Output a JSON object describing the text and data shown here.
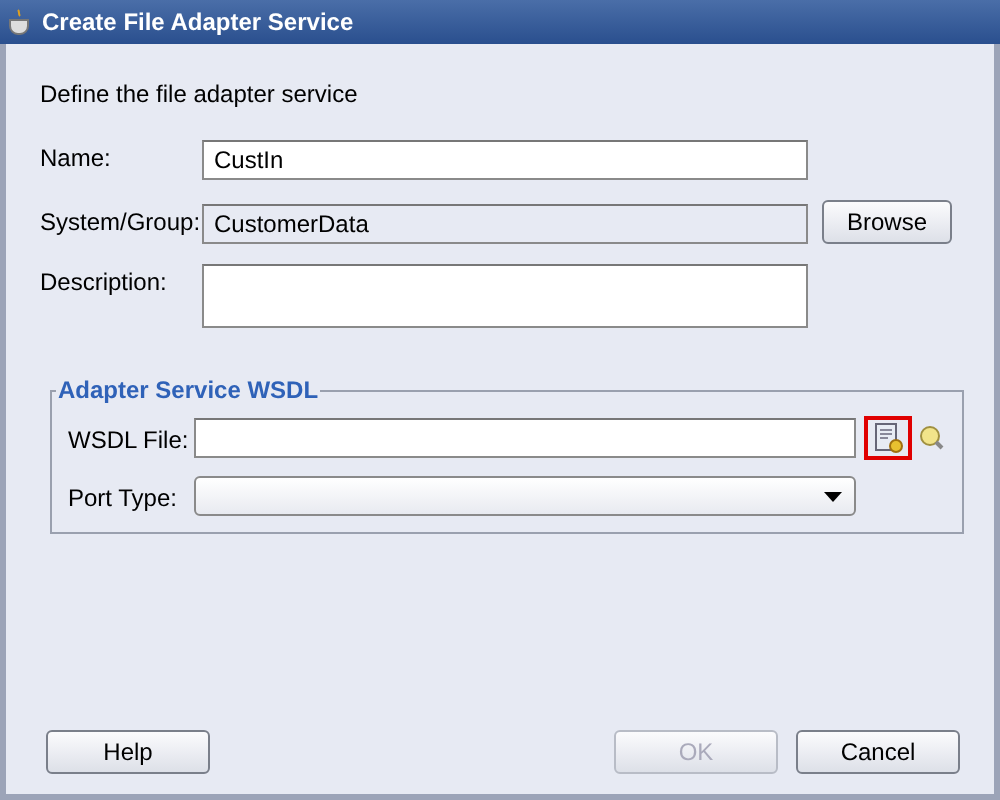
{
  "window": {
    "title": "Create File Adapter Service"
  },
  "intro": "Define the file adapter service",
  "fields": [
    {
      "label": "Name:",
      "value": "CustIn",
      "disabled": false,
      "kind": "text"
    },
    {
      "label": "System/Group:",
      "value": "CustomerData",
      "disabled": true,
      "kind": "text",
      "button": "Browse"
    },
    {
      "label": "Description:",
      "disabled": false,
      "kind": "area"
    }
  ],
  "wsdl_group": {
    "title": "Adapter Service WSDL",
    "fields": [
      {
        "label": "WSDL File:",
        "kind": "file",
        "highlighted": true
      },
      {
        "label": "Port Type:",
        "kind": "select"
      }
    ]
  },
  "left_buttons": [
    {
      "label": "Help",
      "disabled": false
    }
  ],
  "right_buttons": [
    {
      "label": "OK",
      "disabled": true
    },
    {
      "label": "Cancel",
      "disabled": false
    }
  ]
}
